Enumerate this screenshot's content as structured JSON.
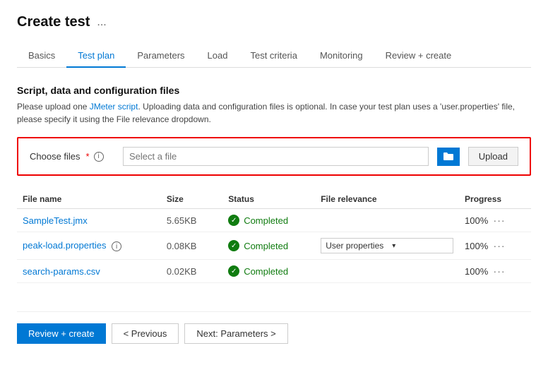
{
  "page": {
    "title": "Create test",
    "dots_label": "..."
  },
  "nav": {
    "tabs": [
      {
        "id": "basics",
        "label": "Basics",
        "active": false
      },
      {
        "id": "test-plan",
        "label": "Test plan",
        "active": true
      },
      {
        "id": "parameters",
        "label": "Parameters",
        "active": false
      },
      {
        "id": "load",
        "label": "Load",
        "active": false
      },
      {
        "id": "test-criteria",
        "label": "Test criteria",
        "active": false
      },
      {
        "id": "monitoring",
        "label": "Monitoring",
        "active": false
      },
      {
        "id": "review-create",
        "label": "Review + create",
        "active": false
      }
    ]
  },
  "section": {
    "title": "Script, data and configuration files",
    "description_part1": "Please upload one JMeter script. Uploading data and configuration files is optional. In case your test plan uses a 'user.properties' file, please specify it using the File relevance dropdown."
  },
  "upload": {
    "label": "Choose files",
    "required_marker": "*",
    "placeholder": "Select a file",
    "upload_button": "Upload"
  },
  "table": {
    "headers": [
      "File name",
      "Size",
      "Status",
      "File relevance",
      "Progress"
    ],
    "rows": [
      {
        "filename": "SampleTest.jmx",
        "size": "5.65KB",
        "status": "Completed",
        "relevance": "",
        "progress": "100%"
      },
      {
        "filename": "peak-load.properties",
        "size": "0.08KB",
        "status": "Completed",
        "relevance": "User properties",
        "progress": "100%",
        "has_info": true
      },
      {
        "filename": "search-params.csv",
        "size": "0.02KB",
        "status": "Completed",
        "relevance": "",
        "progress": "100%"
      }
    ]
  },
  "footer": {
    "review_create": "Review + create",
    "previous": "< Previous",
    "next": "Next: Parameters >"
  }
}
